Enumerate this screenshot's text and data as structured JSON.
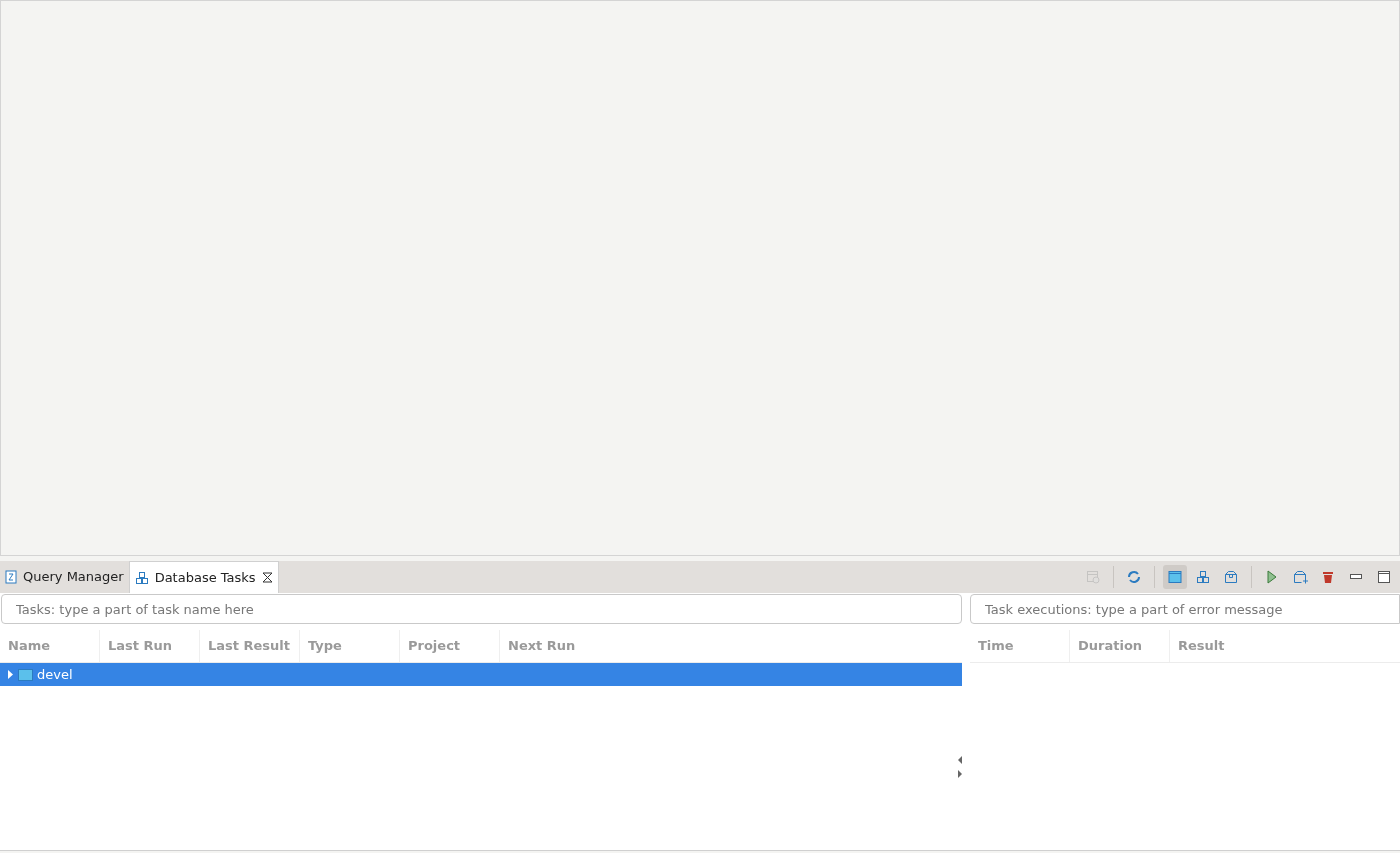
{
  "tabs": [
    {
      "label": "Query Manager",
      "kind": "query",
      "selected": false,
      "closable": false
    },
    {
      "label": "Database Tasks",
      "kind": "tasks",
      "selected": true,
      "closable": true
    }
  ],
  "toolbar": [
    {
      "kind": "schedule",
      "disabled": true,
      "selected": false
    },
    {
      "kind": "sep"
    },
    {
      "kind": "refresh",
      "disabled": false,
      "selected": false
    },
    {
      "kind": "sep"
    },
    {
      "kind": "panel",
      "disabled": false,
      "selected": true
    },
    {
      "kind": "group",
      "disabled": false,
      "selected": false
    },
    {
      "kind": "box",
      "disabled": false,
      "selected": false
    },
    {
      "kind": "sep"
    },
    {
      "kind": "run",
      "disabled": false,
      "selected": false
    },
    {
      "kind": "add",
      "disabled": false,
      "selected": false
    },
    {
      "kind": "delete",
      "disabled": false,
      "selected": false
    },
    {
      "kind": "minimize",
      "disabled": false,
      "selected": false
    },
    {
      "kind": "maximize",
      "disabled": false,
      "selected": false
    }
  ],
  "tasks": {
    "placeholder": "Tasks: type a part of task name here",
    "columns": [
      "Name",
      "Last Run",
      "Last Result",
      "Type",
      "Project",
      "Next Run"
    ],
    "rows": [
      {
        "name": "devel",
        "selected": true,
        "expanded": false
      }
    ]
  },
  "executions": {
    "placeholder": "Task executions: type a part of error message",
    "columns": [
      "Time",
      "Duration",
      "Result"
    ]
  }
}
